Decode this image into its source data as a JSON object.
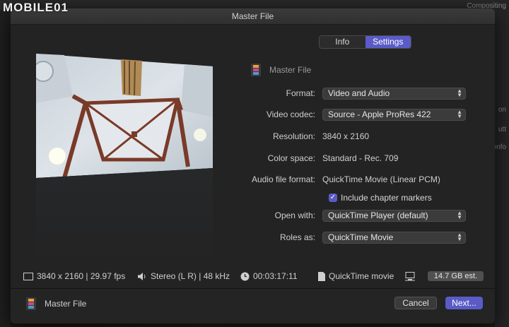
{
  "watermark": "MOBILE01",
  "background": {
    "right_labels": [
      "Compositing",
      "on",
      "utt",
      "onfo"
    ]
  },
  "dialog": {
    "title": "Master File",
    "tabs": [
      {
        "label": "Info",
        "active": false
      },
      {
        "label": "Settings",
        "active": true
      }
    ],
    "file_header": "Master File",
    "settings": {
      "format": {
        "label": "Format:",
        "value": "Video and Audio"
      },
      "video_codec": {
        "label": "Video codec:",
        "value": "Source - Apple ProRes 422"
      },
      "resolution": {
        "label": "Resolution:",
        "value": "3840 x 2160"
      },
      "color_space": {
        "label": "Color space:",
        "value": "Standard - Rec. 709"
      },
      "audio_format": {
        "label": "Audio file format:",
        "value": "QuickTime Movie (Linear PCM)"
      },
      "chapter_markers": {
        "label": "Include chapter markers",
        "checked": true
      },
      "open_with": {
        "label": "Open with:",
        "value": "QuickTime Player (default)"
      },
      "roles_as": {
        "label": "Roles as:",
        "value": "QuickTime Movie"
      }
    },
    "status": {
      "video": "3840 x 2160 | 29.97 fps",
      "audio": "Stereo (L R) | 48 kHz",
      "duration": "00:03:17:11",
      "file_type": "QuickTime movie",
      "size": "14.7 GB est."
    },
    "footer": {
      "file_label": "Master File",
      "cancel": "Cancel",
      "next": "Next..."
    }
  },
  "colors": {
    "accent": "#5a5bc7",
    "dialog_bg": "#232323"
  }
}
